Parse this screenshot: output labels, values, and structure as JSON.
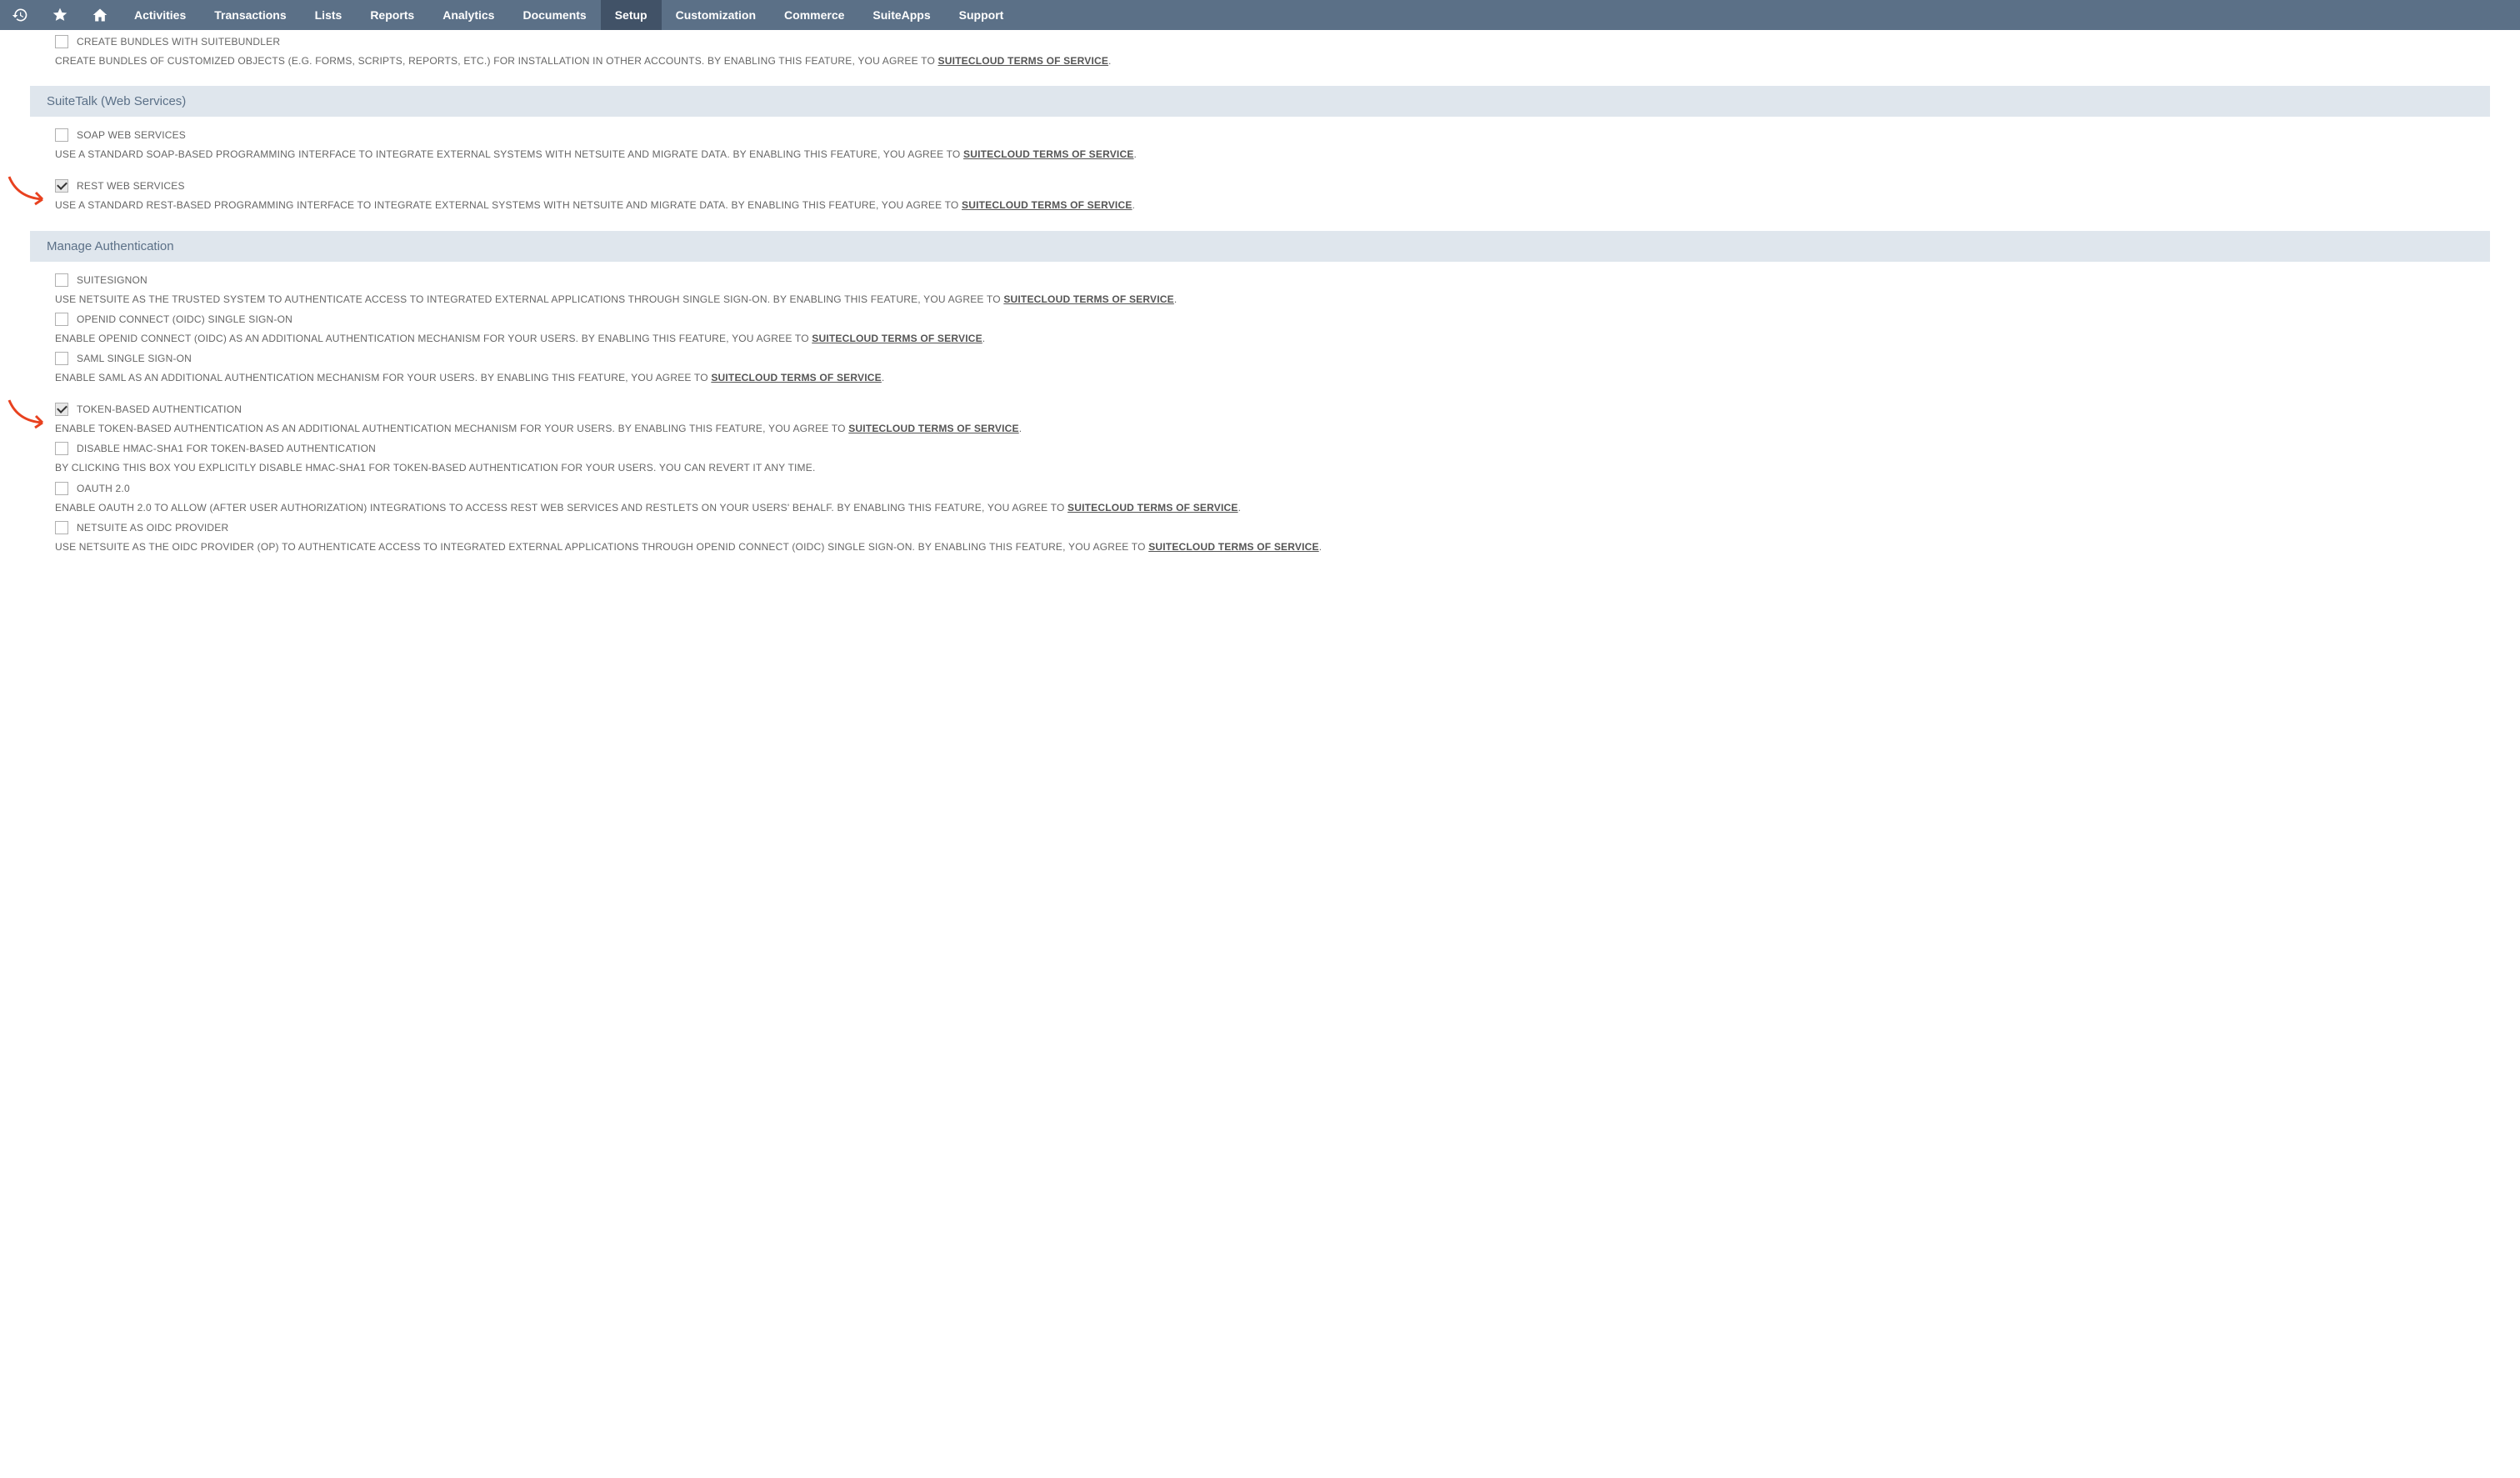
{
  "nav": {
    "items": [
      {
        "label": "Activities",
        "active": false
      },
      {
        "label": "Transactions",
        "active": false
      },
      {
        "label": "Lists",
        "active": false
      },
      {
        "label": "Reports",
        "active": false
      },
      {
        "label": "Analytics",
        "active": false
      },
      {
        "label": "Documents",
        "active": false
      },
      {
        "label": "Setup",
        "active": true
      },
      {
        "label": "Customization",
        "active": false
      },
      {
        "label": "Commerce",
        "active": false
      },
      {
        "label": "SuiteApps",
        "active": false
      },
      {
        "label": "Support",
        "active": false
      }
    ]
  },
  "tos_link_text": "SUITECLOUD TERMS OF SERVICE",
  "sections": {
    "s0_item0": {
      "label": "CREATE BUNDLES WITH SUITEBUNDLER",
      "desc": "CREATE BUNDLES OF CUSTOMIZED OBJECTS (E.G. FORMS, SCRIPTS, REPORTS, ETC.) FOR INSTALLATION IN OTHER ACCOUNTS. BY ENABLING THIS FEATURE, YOU AGREE TO ",
      "checked": false,
      "period": "."
    },
    "s1": {
      "title": "SuiteTalk (Web Services)"
    },
    "s1_item0": {
      "label": "SOAP WEB SERVICES",
      "desc": "USE A STANDARD SOAP-BASED PROGRAMMING INTERFACE TO INTEGRATE EXTERNAL SYSTEMS WITH NETSUITE AND MIGRATE DATA. BY ENABLING THIS FEATURE, YOU AGREE TO ",
      "checked": false,
      "period": "."
    },
    "s1_item1": {
      "label": "REST WEB SERVICES",
      "desc": "USE A STANDARD REST-BASED PROGRAMMING INTERFACE TO INTEGRATE EXTERNAL SYSTEMS WITH NETSUITE AND MIGRATE DATA. BY ENABLING THIS FEATURE, YOU AGREE TO ",
      "checked": true,
      "period": "."
    },
    "s2": {
      "title": "Manage Authentication"
    },
    "s2_item0": {
      "label": "SUITESIGNON",
      "desc": "USE NETSUITE AS THE TRUSTED SYSTEM TO AUTHENTICATE ACCESS TO INTEGRATED EXTERNAL APPLICATIONS THROUGH SINGLE SIGN-ON. BY ENABLING THIS FEATURE, YOU AGREE TO ",
      "checked": false,
      "period": "."
    },
    "s2_item1": {
      "label": "OPENID CONNECT (OIDC) SINGLE SIGN-ON",
      "desc": "ENABLE OPENID CONNECT (OIDC) AS AN ADDITIONAL AUTHENTICATION MECHANISM FOR YOUR USERS. BY ENABLING THIS FEATURE, YOU AGREE TO ",
      "checked": false,
      "period": "."
    },
    "s2_item2": {
      "label": "SAML SINGLE SIGN-ON",
      "desc": "ENABLE SAML AS AN ADDITIONAL AUTHENTICATION MECHANISM FOR YOUR USERS. BY ENABLING THIS FEATURE, YOU AGREE TO ",
      "checked": false,
      "period": "."
    },
    "s2_item3": {
      "label": "TOKEN-BASED AUTHENTICATION",
      "desc": "ENABLE TOKEN-BASED AUTHENTICATION AS AN ADDITIONAL AUTHENTICATION MECHANISM FOR YOUR USERS. BY ENABLING THIS FEATURE, YOU AGREE TO ",
      "checked": true,
      "period": "."
    },
    "s2_item4": {
      "label": "DISABLE HMAC-SHA1 FOR TOKEN-BASED AUTHENTICATION",
      "desc": "BY CLICKING THIS BOX YOU EXPLICITLY DISABLE HMAC-SHA1 FOR TOKEN-BASED AUTHENTICATION FOR YOUR USERS. YOU CAN REVERT IT ANY TIME.",
      "checked": false,
      "has_tos": false
    },
    "s2_item5": {
      "label": "OAUTH 2.0",
      "desc": "ENABLE OAUTH 2.0 TO ALLOW (AFTER USER AUTHORIZATION) INTEGRATIONS TO ACCESS REST WEB SERVICES AND RESTLETS ON YOUR USERS' BEHALF. BY ENABLING THIS FEATURE, YOU AGREE TO ",
      "checked": false,
      "period": "."
    },
    "s2_item6": {
      "label": "NETSUITE AS OIDC PROVIDER",
      "desc": "USE NETSUITE AS THE OIDC PROVIDER (OP) TO AUTHENTICATE ACCESS TO INTEGRATED EXTERNAL APPLICATIONS THROUGH OPENID CONNECT (OIDC) SINGLE SIGN-ON. BY ENABLING THIS FEATURE, YOU AGREE TO ",
      "checked": false,
      "period": "."
    }
  }
}
